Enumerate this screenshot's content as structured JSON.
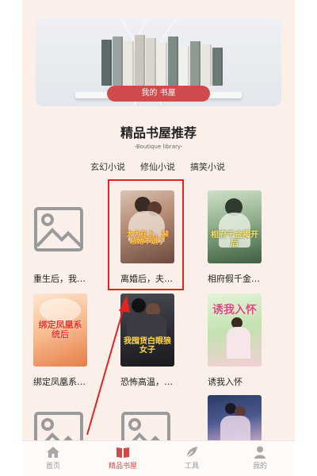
{
  "banner": {
    "button_label": "我的 书屋"
  },
  "section": {
    "title": "精品书屋推荐",
    "subtitle": "-Boutique library-"
  },
  "tabs": [
    {
      "label": "玄幻小说"
    },
    {
      "label": "修仙小说"
    },
    {
      "label": "搞笑小说"
    }
  ],
  "books": [
    {
      "title": "重生后，我…",
      "cover": "placeholder"
    },
    {
      "title": "离婚后，夫…",
      "cover": "romance-couple",
      "cover_text": "太太在上，裴总她不退了"
    },
    {
      "title": "相府假千金…",
      "cover": "ancient-lady",
      "cover_text": "相府千金揭开后"
    },
    {
      "title": "绑定凤凰系…",
      "cover": "phoenix",
      "cover_text": "绑定凤凰系统后"
    },
    {
      "title": "恐怖高温，…",
      "cover": "dark-couple",
      "cover_text": "我囤货白眼狼女子"
    },
    {
      "title": "诱我入怀",
      "cover": "spring-couple",
      "cover_text": "诱我入怀"
    },
    {
      "title": "",
      "cover": "placeholder"
    },
    {
      "title": "",
      "cover": "placeholder"
    },
    {
      "title": "",
      "cover": "night-couple"
    }
  ],
  "tabbar": [
    {
      "label": "首页",
      "icon": "home-icon",
      "active": false
    },
    {
      "label": "精品书屋",
      "icon": "book-icon",
      "active": true
    },
    {
      "label": "工具",
      "icon": "leaf-icon",
      "active": false
    },
    {
      "label": "我的",
      "icon": "user-icon",
      "active": false
    }
  ],
  "colors": {
    "accent": "#cf4b4b",
    "annotation": "#e02424",
    "background": "#fbefe9"
  }
}
